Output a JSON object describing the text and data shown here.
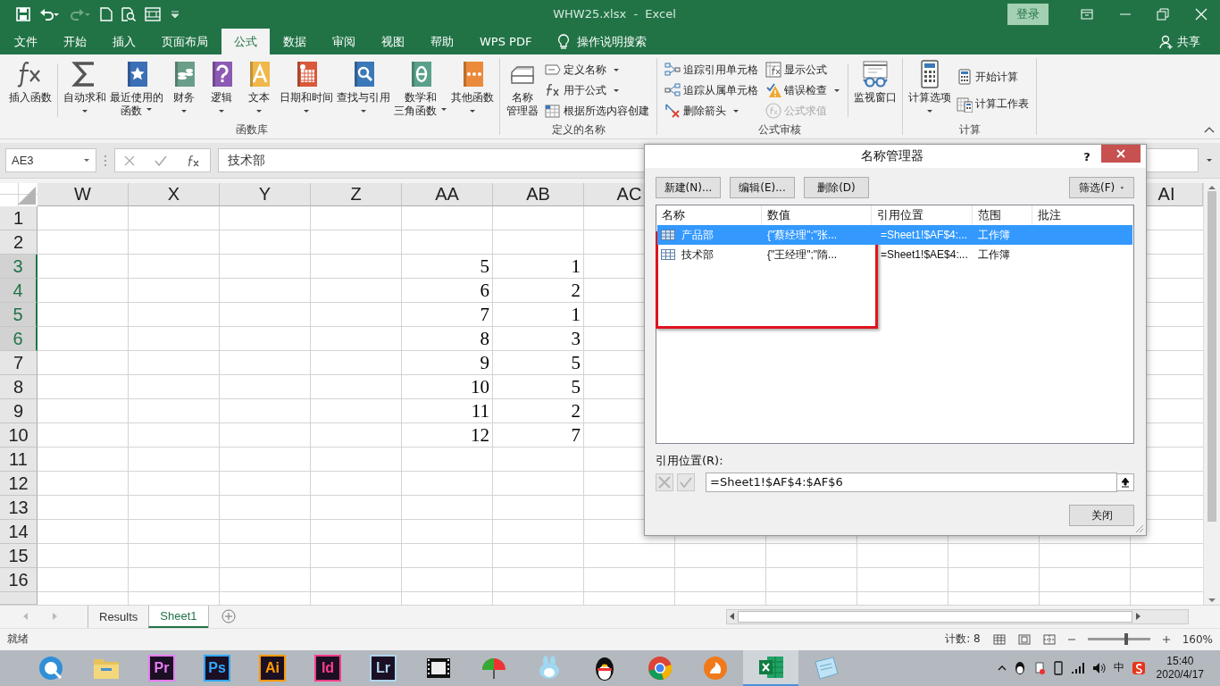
{
  "window": {
    "title": "WHW25.xlsx  -  Excel",
    "sign_in": "登录"
  },
  "ribbon_tabs": [
    {
      "label": "文件",
      "selected": false
    },
    {
      "label": "开始",
      "selected": false
    },
    {
      "label": "插入",
      "selected": false
    },
    {
      "label": "页面布局",
      "selected": false
    },
    {
      "label": "公式",
      "selected": true
    },
    {
      "label": "数据",
      "selected": false
    },
    {
      "label": "审阅",
      "selected": false
    },
    {
      "label": "视图",
      "selected": false
    },
    {
      "label": "帮助",
      "selected": false
    },
    {
      "label": "WPS PDF",
      "selected": false
    }
  ],
  "tell_me": "操作说明搜索",
  "share": "共享",
  "ribbon_groups": [
    {
      "label": "函数库",
      "items": [
        {
          "kind": "large",
          "lines": [
            "插入函数"
          ],
          "dropdown": false
        },
        {
          "kind": "separator"
        },
        {
          "kind": "large",
          "lines": [
            "自动求和"
          ],
          "dropdown": true
        },
        {
          "kind": "large",
          "lines": [
            "最近使用的",
            "函数"
          ],
          "dropdown": true
        },
        {
          "kind": "large",
          "lines": [
            "财务"
          ],
          "dropdown": true
        },
        {
          "kind": "large",
          "lines": [
            "逻辑"
          ],
          "dropdown": true
        },
        {
          "kind": "large",
          "lines": [
            "文本"
          ],
          "dropdown": true
        },
        {
          "kind": "large",
          "lines": [
            "日期和时间"
          ],
          "dropdown": true
        },
        {
          "kind": "large",
          "lines": [
            "查找与引用"
          ],
          "dropdown": true
        },
        {
          "kind": "large",
          "lines": [
            "数学和",
            "三角函数"
          ],
          "dropdown": true
        },
        {
          "kind": "large",
          "lines": [
            "其他函数"
          ],
          "dropdown": true
        }
      ]
    },
    {
      "label": "定义的名称",
      "items": [
        {
          "kind": "large",
          "lines": [
            "名称",
            "管理器"
          ],
          "dropdown": false
        },
        {
          "kind": "stack",
          "items": [
            {
              "label": "定义名称",
              "dropdown": true,
              "disabled": false
            },
            {
              "label": "用于公式",
              "dropdown": true,
              "disabled": false
            },
            {
              "label": "根据所选内容创建",
              "dropdown": false,
              "disabled": false
            }
          ]
        }
      ]
    },
    {
      "label": "公式审核",
      "items": [
        {
          "kind": "stack",
          "items": [
            {
              "label": "追踪引用单元格",
              "dropdown": false,
              "disabled": false
            },
            {
              "label": "追踪从属单元格",
              "dropdown": false,
              "disabled": false
            },
            {
              "label": "删除箭头",
              "dropdown": true,
              "disabled": false
            }
          ]
        },
        {
          "kind": "stack",
          "items": [
            {
              "label": "显示公式",
              "dropdown": false,
              "disabled": false
            },
            {
              "label": "错误检查",
              "dropdown": true,
              "disabled": false
            },
            {
              "label": "公式求值",
              "dropdown": false,
              "disabled": true
            }
          ]
        },
        {
          "kind": "separator"
        },
        {
          "kind": "large",
          "lines": [
            "监视窗口"
          ],
          "dropdown": false
        }
      ]
    },
    {
      "label": "计算",
      "items": [
        {
          "kind": "large",
          "lines": [
            "计算选项"
          ],
          "dropdown": true
        },
        {
          "kind": "stack",
          "items": [
            {
              "label": "开始计算",
              "dropdown": false,
              "disabled": false
            },
            {
              "label": "计算工作表",
              "dropdown": false,
              "disabled": false
            }
          ]
        }
      ]
    }
  ],
  "formula_bar": {
    "name_box": "AE3",
    "content": "技术部"
  },
  "sheet": {
    "columns": [
      "W",
      "X",
      "Y",
      "Z",
      "AA",
      "AB",
      "AC",
      "AI"
    ],
    "rows": [
      {
        "number": "1",
        "selected": false
      },
      {
        "number": "2",
        "selected": false
      },
      {
        "number": "3",
        "selected": true,
        "AA": "5",
        "AB": "1"
      },
      {
        "number": "4",
        "selected": true,
        "AA": "6",
        "AB": "2"
      },
      {
        "number": "5",
        "selected": true,
        "AA": "7",
        "AB": "1"
      },
      {
        "number": "6",
        "selected": true,
        "AA": "8",
        "AB": "3"
      },
      {
        "number": "7",
        "selected": false,
        "AA": "9",
        "AB": "5"
      },
      {
        "number": "8",
        "selected": false,
        "AA": "10",
        "AB": "5"
      },
      {
        "number": "9",
        "selected": false,
        "AA": "11",
        "AB": "2"
      },
      {
        "number": "10",
        "selected": false,
        "AA": "12",
        "AB": "7"
      },
      {
        "number": "11",
        "selected": false
      },
      {
        "number": "12",
        "selected": false
      },
      {
        "number": "13",
        "selected": false
      },
      {
        "number": "14",
        "selected": false
      },
      {
        "number": "15",
        "selected": false
      },
      {
        "number": "16",
        "selected": false
      }
    ]
  },
  "dialog": {
    "title": "名称管理器",
    "help": "?",
    "buttons": [
      "新建(N)...",
      "编辑(E)...",
      "删除(D)"
    ],
    "filter": "筛选(F)",
    "columns": [
      "名称",
      "数值",
      "引用位置",
      "范围",
      "批注"
    ],
    "rows": [
      {
        "name": "产品部",
        "value": "{\"蔡经理\";\"张...",
        "refers_to": "=Sheet1!$AF$4:...",
        "scope": "工作簿",
        "selected": true
      },
      {
        "name": "技术部",
        "value": "{\"王经理\";\"隋...",
        "refers_to": "=Sheet1!$AE$4:...",
        "scope": "工作簿",
        "selected": false
      }
    ],
    "refers_label": "引用位置(R):",
    "refers_value": "=Sheet1!$AF$4:$AF$6",
    "close": "关闭"
  },
  "sheet_tabs": [
    {
      "label": "Results",
      "selected": false
    },
    {
      "label": "Sheet1",
      "selected": true
    }
  ],
  "status_bar": {
    "ready": "就绪",
    "count": "计数: 8",
    "zoom": "160%",
    "zoom_slider": {
      "level": 0.62
    }
  },
  "taskbar": {
    "apps": [
      {
        "kind": "globe",
        "selected": false
      },
      {
        "kind": "folder",
        "selected": false
      },
      {
        "kind": "letters",
        "text": "Pr",
        "color": "#e77cf2",
        "selected": false
      },
      {
        "kind": "letters",
        "text": "Ps",
        "color": "#31a8ff",
        "selected": false
      },
      {
        "kind": "letters",
        "text": "Ai",
        "color": "#ff9a00",
        "selected": false
      },
      {
        "kind": "letters",
        "text": "Id",
        "color": "#ff3d8b",
        "selected": false
      },
      {
        "kind": "letters",
        "text": "Lr",
        "color": "#add5ec",
        "selected": false
      },
      {
        "kind": "film",
        "selected": false
      },
      {
        "kind": "umbrella",
        "selected": false
      },
      {
        "kind": "bird",
        "selected": false
      },
      {
        "kind": "penguin",
        "selected": false
      },
      {
        "kind": "chrome",
        "selected": false
      },
      {
        "kind": "flame",
        "selected": false
      },
      {
        "kind": "excel",
        "selected": true
      },
      {
        "kind": "notepad",
        "selected": false
      }
    ],
    "ime": "中",
    "time": "15:40",
    "date": "2020/4/17"
  }
}
